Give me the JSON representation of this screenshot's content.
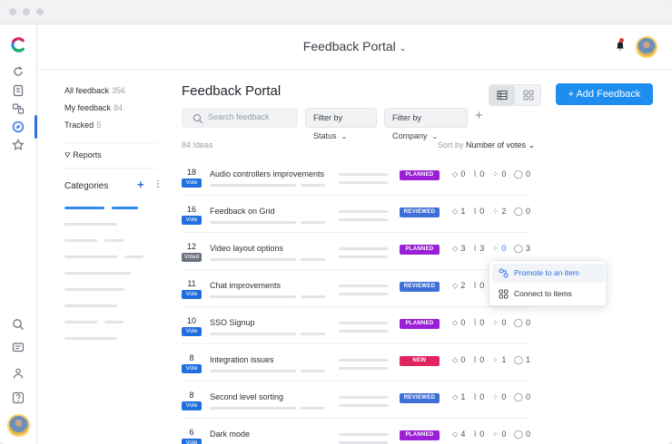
{
  "header": {
    "title": "Feedback Portal"
  },
  "sidebar": {
    "links": [
      {
        "label": "All feedback",
        "count": "356"
      },
      {
        "label": "My feedback",
        "count": "84"
      },
      {
        "label": "Tracked",
        "count": "5"
      }
    ],
    "reports_label": "Reports",
    "categories_label": "Categories"
  },
  "main": {
    "title": "Feedback Portal",
    "add_button": "+ Add Feedback",
    "search_placeholder": "Search feedback",
    "filter_status": "Filter by Status",
    "filter_company": "Filter by Company",
    "idea_count": "84 Ideas",
    "sort_prefix": "Sort by",
    "sort_value": "Number of votes"
  },
  "rows": [
    {
      "votes": "18",
      "vote_label": "Vote",
      "title": "Audio controllers improvements",
      "status": "PLANNED",
      "status_color": "#9b1fd6",
      "tags": "0",
      "attach": "0",
      "items": "0",
      "comments": "0"
    },
    {
      "votes": "16",
      "vote_label": "Vote",
      "title": "Feedback on Grid",
      "status": "REVIEWED",
      "status_color": "#3f6fd9",
      "tags": "1",
      "attach": "0",
      "items": "2",
      "comments": "0"
    },
    {
      "votes": "12",
      "vote_label": "Voted",
      "title": "Video layout options",
      "status": "PLANNED",
      "status_color": "#9b1fd6",
      "tags": "3",
      "attach": "3",
      "items": "0",
      "comments": "3"
    },
    {
      "votes": "11",
      "vote_label": "Vote",
      "title": "Chat improvements",
      "status": "REVIEWED",
      "status_color": "#3f6fd9",
      "tags": "2",
      "attach": "0",
      "items": "",
      "comments": ""
    },
    {
      "votes": "10",
      "vote_label": "Vote",
      "title": "SSO Signup",
      "status": "PLANNED",
      "status_color": "#9b1fd6",
      "tags": "0",
      "attach": "0",
      "items": "0",
      "comments": "0"
    },
    {
      "votes": "8",
      "vote_label": "Vote",
      "title": "Integration issues",
      "status": "NEW",
      "status_color": "#e0245e",
      "tags": "0",
      "attach": "0",
      "items": "1",
      "comments": "1"
    },
    {
      "votes": "8",
      "vote_label": "Vote",
      "title": "Second level sorting",
      "status": "REVIEWED",
      "status_color": "#3f6fd9",
      "tags": "1",
      "attach": "0",
      "items": "0",
      "comments": "0"
    },
    {
      "votes": "6",
      "vote_label": "Vote",
      "title": "Dark mode",
      "status": "PLANNED",
      "status_color": "#9b1fd6",
      "tags": "4",
      "attach": "0",
      "items": "0",
      "comments": "0"
    }
  ],
  "popover": {
    "items": [
      {
        "label": "Promote to an item"
      },
      {
        "label": "Connect to items"
      }
    ]
  }
}
